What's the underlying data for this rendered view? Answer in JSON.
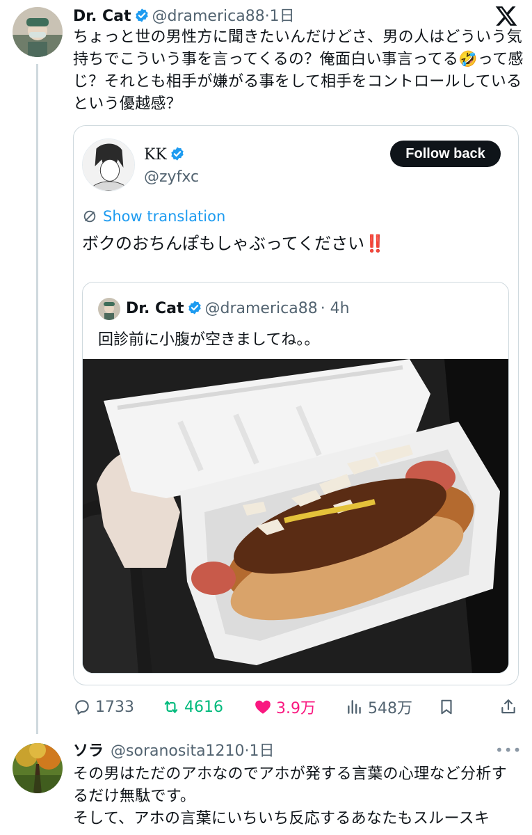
{
  "main_tweet": {
    "author_name": "Dr. Cat",
    "handle": "@dramerica88",
    "time": "·1日",
    "text": "ちょっと世の男性方に聞きたいんだけどさ、男の人はどういう気持ちでこういう事を言ってくるの？俺面白い事言ってる🤣って感じ？それとも相手が嫌がる事をして相手をコントロールしているという優越感？"
  },
  "x_logo_icon": "x-logo-icon",
  "quoted_tweet": {
    "author_name": "KK",
    "handle": "@zyfxc",
    "follow_label": "Follow back",
    "translation_label": "Show translation",
    "text": "ボクのおちんぽもしゃぶってください‼️"
  },
  "nested_quote": {
    "author_name": "Dr. Cat",
    "handle": "@dramerica88",
    "time": "· 4h",
    "text": "回診前に小腹が空きましてね。。"
  },
  "actions": {
    "replies": "1733",
    "retweets": "4616",
    "likes": "3.9万",
    "views": "548万"
  },
  "reply": {
    "author_name": "ソラ",
    "handle": "@soranosita1210",
    "time": "·1日",
    "text": "その男はただのアホなのでアホが発する言葉の心理など分析するだけ無駄です。",
    "text2": "そして、アホの言葉にいちいち反応するあなたもスルースキ"
  },
  "colors": {
    "accent": "#1d9bf0",
    "retweet": "#00ba7c",
    "like": "#f91880",
    "text": "#0f1419",
    "muted": "#536471"
  }
}
